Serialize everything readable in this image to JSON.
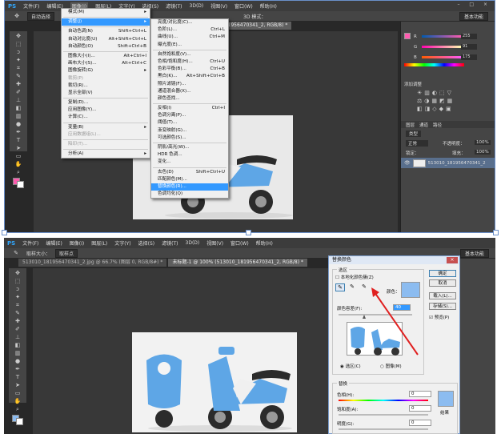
{
  "menubar": {
    "logo": "PS",
    "items": [
      "文件(F)",
      "编辑(E)",
      "图像(I)",
      "图层(L)",
      "文字(Y)",
      "选择(S)",
      "滤镜(T)",
      "3D(D)",
      "视图(V)",
      "窗口(W)",
      "帮助(H)"
    ],
    "window_controls": "– □ ×"
  },
  "optbar1": {
    "tool": "自动选择",
    "mode": "3D 模式：",
    "workspace": "基本功能"
  },
  "optbar2": {
    "size_label": "取样大小：",
    "size_value": "取样点",
    "workspace": "基本功能"
  },
  "tabs1": [
    "513010_181956470341_2 ... @ 66.7% (图层 0, RGB/8) *"
  ],
  "tabs1_short": "513010_181956470341_2, RGB/8) *",
  "tabs2": [
    {
      "label": "513010_181956470341_2.jpg @ 66.7% (图层 0, RGB/8#) *"
    },
    {
      "label": "未标题-1 @ 100% (513010_181956470341_2, RGB/8) *"
    }
  ],
  "image_menu": {
    "items": [
      {
        "label": "模式(M)",
        "shortcut": "▸"
      },
      {
        "label": "调整(J)",
        "shortcut": "▸",
        "highlight": true
      },
      {
        "label": "自动色调(N)",
        "shortcut": "Shift+Ctrl+L"
      },
      {
        "label": "自动对比度(U)",
        "shortcut": "Alt+Shift+Ctrl+L"
      },
      {
        "label": "自动颜色(O)",
        "shortcut": "Shift+Ctrl+B"
      },
      {
        "label": "图像大小(I)...",
        "shortcut": "Alt+Ctrl+I"
      },
      {
        "label": "画布大小(S)...",
        "shortcut": "Alt+Ctrl+C"
      },
      {
        "label": "图像旋转(G)",
        "shortcut": "▸"
      },
      {
        "label": "裁剪(P)",
        "shortcut": "",
        "disabled": true
      },
      {
        "label": "裁切(R)...",
        "shortcut": ""
      },
      {
        "label": "显示全部(V)",
        "shortcut": ""
      },
      {
        "label": "复制(D)...",
        "shortcut": ""
      },
      {
        "label": "应用图像(Y)...",
        "shortcut": ""
      },
      {
        "label": "计算(C)...",
        "shortcut": ""
      },
      {
        "label": "变量(B)",
        "shortcut": "▸"
      },
      {
        "label": "应用数据组(L)...",
        "shortcut": "",
        "disabled": true
      },
      {
        "label": "陷印(T)...",
        "shortcut": "",
        "disabled": true
      },
      {
        "label": "分析(A)",
        "shortcut": "▸"
      }
    ]
  },
  "adjust_menu": {
    "items": [
      {
        "label": "亮度/对比度(C)...",
        "shortcut": ""
      },
      {
        "label": "色阶(L)...",
        "shortcut": "Ctrl+L"
      },
      {
        "label": "曲线(U)...",
        "shortcut": "Ctrl+M"
      },
      {
        "label": "曝光度(E)...",
        "shortcut": ""
      },
      {
        "label": "自然饱和度(V)...",
        "shortcut": ""
      },
      {
        "label": "色相/饱和度(H)...",
        "shortcut": "Ctrl+U"
      },
      {
        "label": "色彩平衡(B)...",
        "shortcut": "Ctrl+B"
      },
      {
        "label": "黑白(K)...",
        "shortcut": "Alt+Shift+Ctrl+B"
      },
      {
        "label": "照片滤镜(F)...",
        "shortcut": ""
      },
      {
        "label": "通道混合器(X)...",
        "shortcut": ""
      },
      {
        "label": "颜色查找...",
        "shortcut": ""
      },
      {
        "label": "反相(I)",
        "shortcut": "Ctrl+I"
      },
      {
        "label": "色调分离(P)...",
        "shortcut": ""
      },
      {
        "label": "阈值(T)...",
        "shortcut": ""
      },
      {
        "label": "渐变映射(G)...",
        "shortcut": ""
      },
      {
        "label": "可选颜色(S)...",
        "shortcut": ""
      },
      {
        "label": "阴影/高光(W)...",
        "shortcut": ""
      },
      {
        "label": "HDR 色调...",
        "shortcut": ""
      },
      {
        "label": "变化...",
        "shortcut": ""
      },
      {
        "label": "去色(D)",
        "shortcut": "Shift+Ctrl+U"
      },
      {
        "label": "匹配颜色(M)...",
        "shortcut": ""
      },
      {
        "label": "替换颜色(R)...",
        "shortcut": "",
        "highlight": true
      },
      {
        "label": "色调均化(Q)",
        "shortcut": ""
      }
    ]
  },
  "color_panel": {
    "r": "255",
    "g": "91",
    "b": "175"
  },
  "adjust_panel": {
    "title": "添加调整"
  },
  "layers_panel": {
    "tabs": [
      "图层",
      "通道",
      "路径"
    ],
    "kind": "类型",
    "blend": "正常",
    "opacity_label": "不透明度：",
    "opacity": "100%",
    "lock_label": "锁定：",
    "fill_label": "填充：",
    "fill": "100%",
    "layer_name": "513010_181956470341_2"
  },
  "dialog": {
    "title": "替换颜色",
    "close": "×",
    "select_group": "选区",
    "localized": "本地化颜色簇(Z)",
    "color_label": "颜色：",
    "fuzziness_label": "颜色容差(F):",
    "fuzziness": "40",
    "radio_selection": "选区(C)",
    "radio_image": "图像(M)",
    "replace_group": "替换",
    "hue_label": "色相(H):",
    "hue": "0",
    "saturation_label": "饱和度(A):",
    "saturation": "0",
    "lightness_label": "明度(G):",
    "lightness": "0",
    "result_label": "结果",
    "ok": "确定",
    "cancel": "取消",
    "load": "载入(L)...",
    "save": "存储(S)...",
    "preview": "预览(P)",
    "eyedropper_icons": [
      "eyedropper-icon",
      "eyedropper-plus-icon",
      "eyedropper-minus-icon"
    ]
  },
  "colors": {
    "accent": "#3399ff",
    "pink": "#ff5baf",
    "sample": "#8cbcf0",
    "scooter": "#5ea6e6"
  }
}
